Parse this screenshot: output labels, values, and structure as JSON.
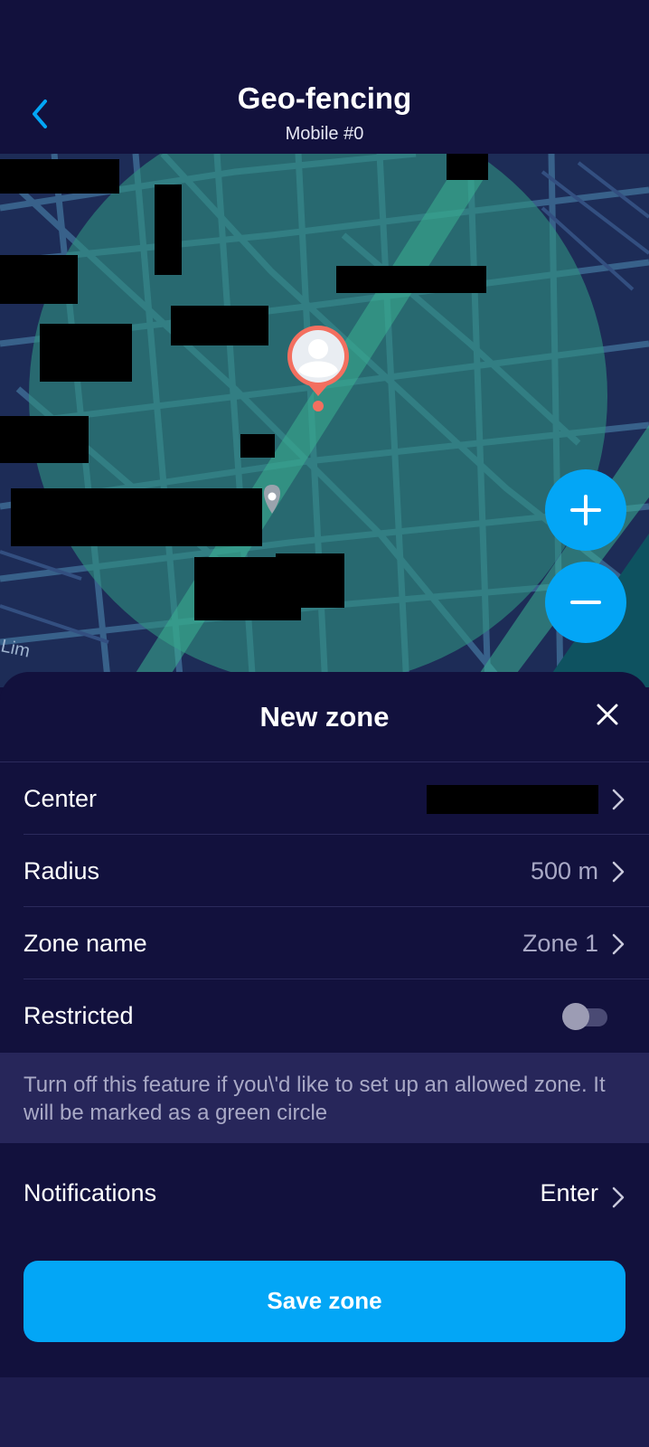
{
  "header": {
    "title": "Geo-fencing",
    "subtitle": "Mobile #0",
    "back_icon": "chevron-left-icon"
  },
  "map": {
    "zone_color": "#2f8f80",
    "pin_color": "#f36f5f",
    "street_label": "Lim",
    "zoom_in_icon": "plus-icon",
    "zoom_out_icon": "minus-icon"
  },
  "sheet": {
    "title": "New zone",
    "close_icon": "close-icon",
    "rows": {
      "center": {
        "label": "Center",
        "value": ""
      },
      "radius": {
        "label": "Radius",
        "value": "500 m"
      },
      "zone_name": {
        "label": "Zone name",
        "value": "Zone 1"
      },
      "restricted": {
        "label": "Restricted",
        "enabled": false
      },
      "notifications": {
        "label": "Notifications",
        "value": "Enter"
      }
    },
    "info": "Turn off this feature if you\\'d like to set up an allowed zone. It will be marked as a green circle",
    "save_label": "Save zone"
  },
  "colors": {
    "background": "#12113d",
    "accent": "#03a6f6",
    "info_box": "#27265a",
    "muted_text": "#a9a9c6"
  }
}
